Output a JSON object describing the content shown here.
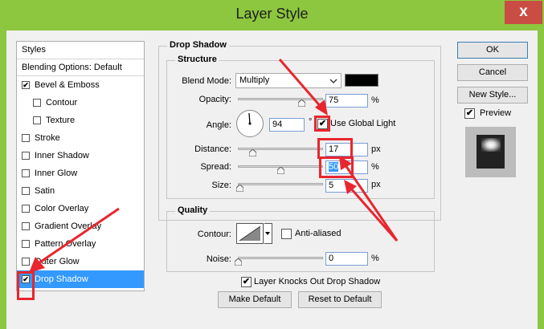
{
  "window": {
    "title": "Layer Style",
    "close_glyph": "x"
  },
  "styles_panel": {
    "header": "Styles",
    "blending_options": "Blending Options: Default",
    "items": [
      {
        "label": "Bevel & Emboss",
        "checked": true,
        "indent": false
      },
      {
        "label": "Contour",
        "checked": false,
        "indent": true
      },
      {
        "label": "Texture",
        "checked": false,
        "indent": true
      },
      {
        "label": "Stroke",
        "checked": false,
        "indent": false
      },
      {
        "label": "Inner Shadow",
        "checked": false,
        "indent": false
      },
      {
        "label": "Inner Glow",
        "checked": false,
        "indent": false
      },
      {
        "label": "Satin",
        "checked": false,
        "indent": false
      },
      {
        "label": "Color Overlay",
        "checked": false,
        "indent": false
      },
      {
        "label": "Gradient Overlay",
        "checked": false,
        "indent": false
      },
      {
        "label": "Pattern Overlay",
        "checked": false,
        "indent": false
      },
      {
        "label": "Outer Glow",
        "checked": false,
        "indent": false
      },
      {
        "label": "Drop Shadow",
        "checked": true,
        "indent": false,
        "selected": true
      }
    ]
  },
  "drop_shadow": {
    "group_title": "Drop Shadow",
    "structure_title": "Structure",
    "blend_mode_label": "Blend Mode:",
    "blend_mode_value": "Multiply",
    "shadow_color": "#000000",
    "opacity_label": "Opacity:",
    "opacity_value": "75",
    "opacity_unit": "%",
    "angle_label": "Angle:",
    "angle_value": "94",
    "angle_unit": "°",
    "use_global_light_label": "Use Global Light",
    "use_global_light_checked": true,
    "distance_label": "Distance:",
    "distance_value": "17",
    "distance_unit": "px",
    "spread_label": "Spread:",
    "spread_value": "50",
    "spread_unit": "%",
    "size_label": "Size:",
    "size_value": "5",
    "size_unit": "px",
    "quality_title": "Quality",
    "contour_label": "Contour:",
    "anti_aliased_label": "Anti-aliased",
    "anti_aliased_checked": false,
    "noise_label": "Noise:",
    "noise_value": "0",
    "noise_unit": "%",
    "knocks_out_label": "Layer Knocks Out Drop Shadow",
    "knocks_out_checked": true,
    "make_default_label": "Make Default",
    "reset_default_label": "Reset to Default"
  },
  "sliders": {
    "opacity": 0.75,
    "distance": 0.17,
    "spread": 0.5,
    "size": 0.02,
    "noise": 0.0
  },
  "buttons": {
    "ok": "OK",
    "cancel": "Cancel",
    "new_style": "New Style...",
    "preview_label": "Preview",
    "preview_checked": true
  },
  "colors": {
    "title_bar": "#8dc63f",
    "close_button": "#c94c45",
    "selection": "#3399ff",
    "annotation": "#e8262e"
  },
  "check_glyph": "✔"
}
